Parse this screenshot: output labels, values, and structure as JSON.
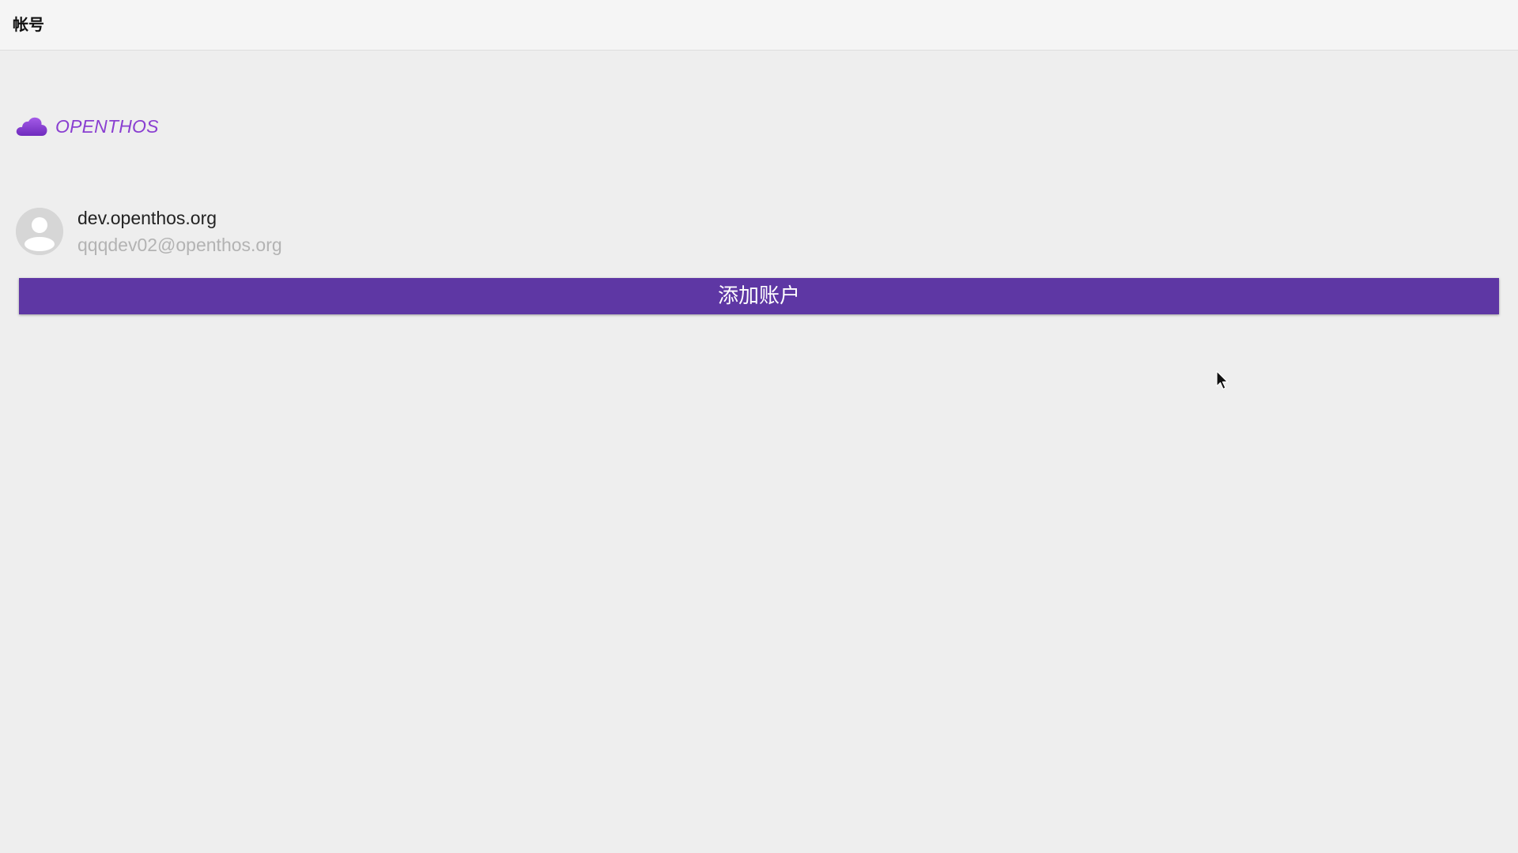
{
  "titlebar": {
    "title": "帐号"
  },
  "brand": {
    "icon": "cloud-icon",
    "name": "OPENTHOS",
    "color": "#8a3fd1"
  },
  "account": {
    "avatar_icon": "person-icon",
    "name": "dev.openthos.org",
    "email": "qqqdev02@openthos.org"
  },
  "add_account": {
    "label": "添加账户",
    "color": "#5e37a4"
  },
  "colors": {
    "background": "#eeeeee",
    "titlebar": "#f5f5f5",
    "email_text": "#b3b3b3"
  }
}
